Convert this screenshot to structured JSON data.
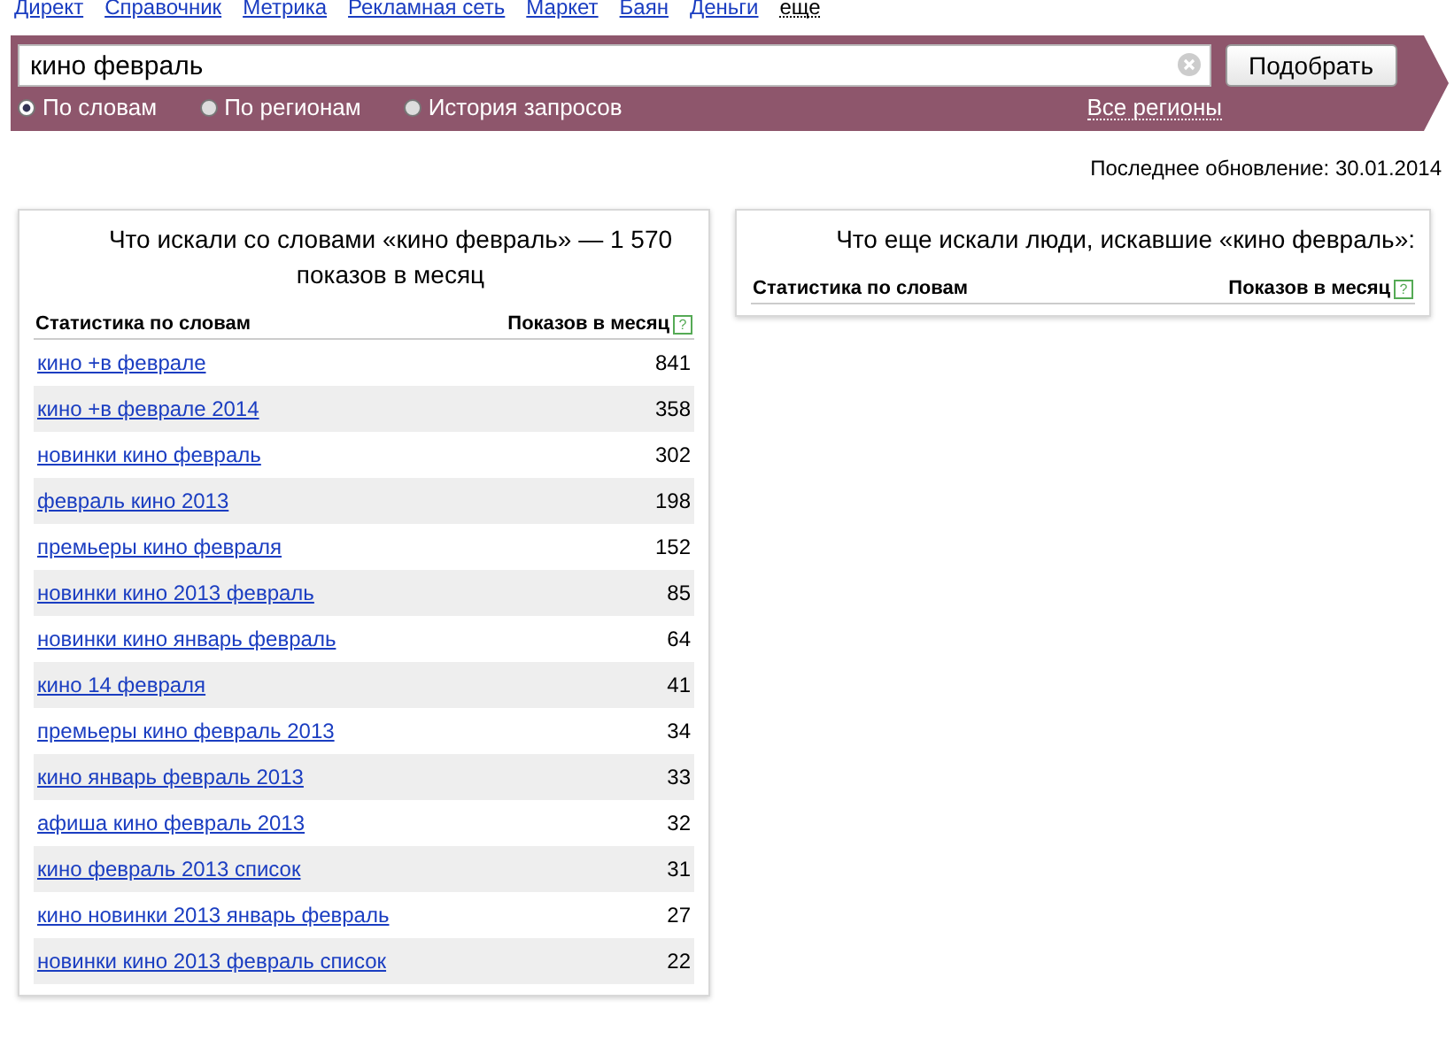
{
  "top_nav": [
    {
      "label": "Директ",
      "kind": "link"
    },
    {
      "label": "Справочник",
      "kind": "link"
    },
    {
      "label": "Метрика",
      "kind": "link"
    },
    {
      "label": "Рекламная сеть",
      "kind": "link"
    },
    {
      "label": "Маркет",
      "kind": "link"
    },
    {
      "label": "Баян",
      "kind": "link"
    },
    {
      "label": "Деньги",
      "kind": "link"
    },
    {
      "label": "еще",
      "kind": "dropdown"
    }
  ],
  "search": {
    "value": "кино февраль",
    "button": "Подобрать",
    "modes": [
      {
        "label": "По словам",
        "selected": true
      },
      {
        "label": "По регионам",
        "selected": false
      },
      {
        "label": "История запросов",
        "selected": false
      }
    ],
    "regions_link": "Все регионы"
  },
  "last_update": "Последнее обновление: 30.01.2014",
  "left_panel": {
    "title": "Что искали со словами «кино февраль» — 1 570 показов в месяц",
    "columns": [
      "Статистика по словам",
      "Показов в месяц"
    ],
    "help_mark": "?",
    "rows": [
      {
        "phrase": "кино +в феврале",
        "count": "841"
      },
      {
        "phrase": "кино +в феврале 2014",
        "count": "358"
      },
      {
        "phrase": "новинки кино февраль",
        "count": "302"
      },
      {
        "phrase": "февраль кино 2013",
        "count": "198"
      },
      {
        "phrase": "премьеры кино февраля",
        "count": "152"
      },
      {
        "phrase": "новинки кино 2013 февраль",
        "count": "85"
      },
      {
        "phrase": "новинки кино январь февраль",
        "count": "64"
      },
      {
        "phrase": "кино 14 февраля",
        "count": "41"
      },
      {
        "phrase": "премьеры кино февраль 2013",
        "count": "34"
      },
      {
        "phrase": "кино январь февраль 2013",
        "count": "33"
      },
      {
        "phrase": "афиша кино февраль 2013",
        "count": "32"
      },
      {
        "phrase": "кино февраль 2013 список",
        "count": "31"
      },
      {
        "phrase": "кино новинки 2013 январь февраль",
        "count": "27"
      },
      {
        "phrase": "новинки кино 2013 февраль список",
        "count": "22"
      }
    ]
  },
  "right_panel": {
    "title": "Что еще искали люди, искавшие «кино февраль»:",
    "columns": [
      "Статистика по словам",
      "Показов в месяц"
    ],
    "help_mark": "?"
  }
}
